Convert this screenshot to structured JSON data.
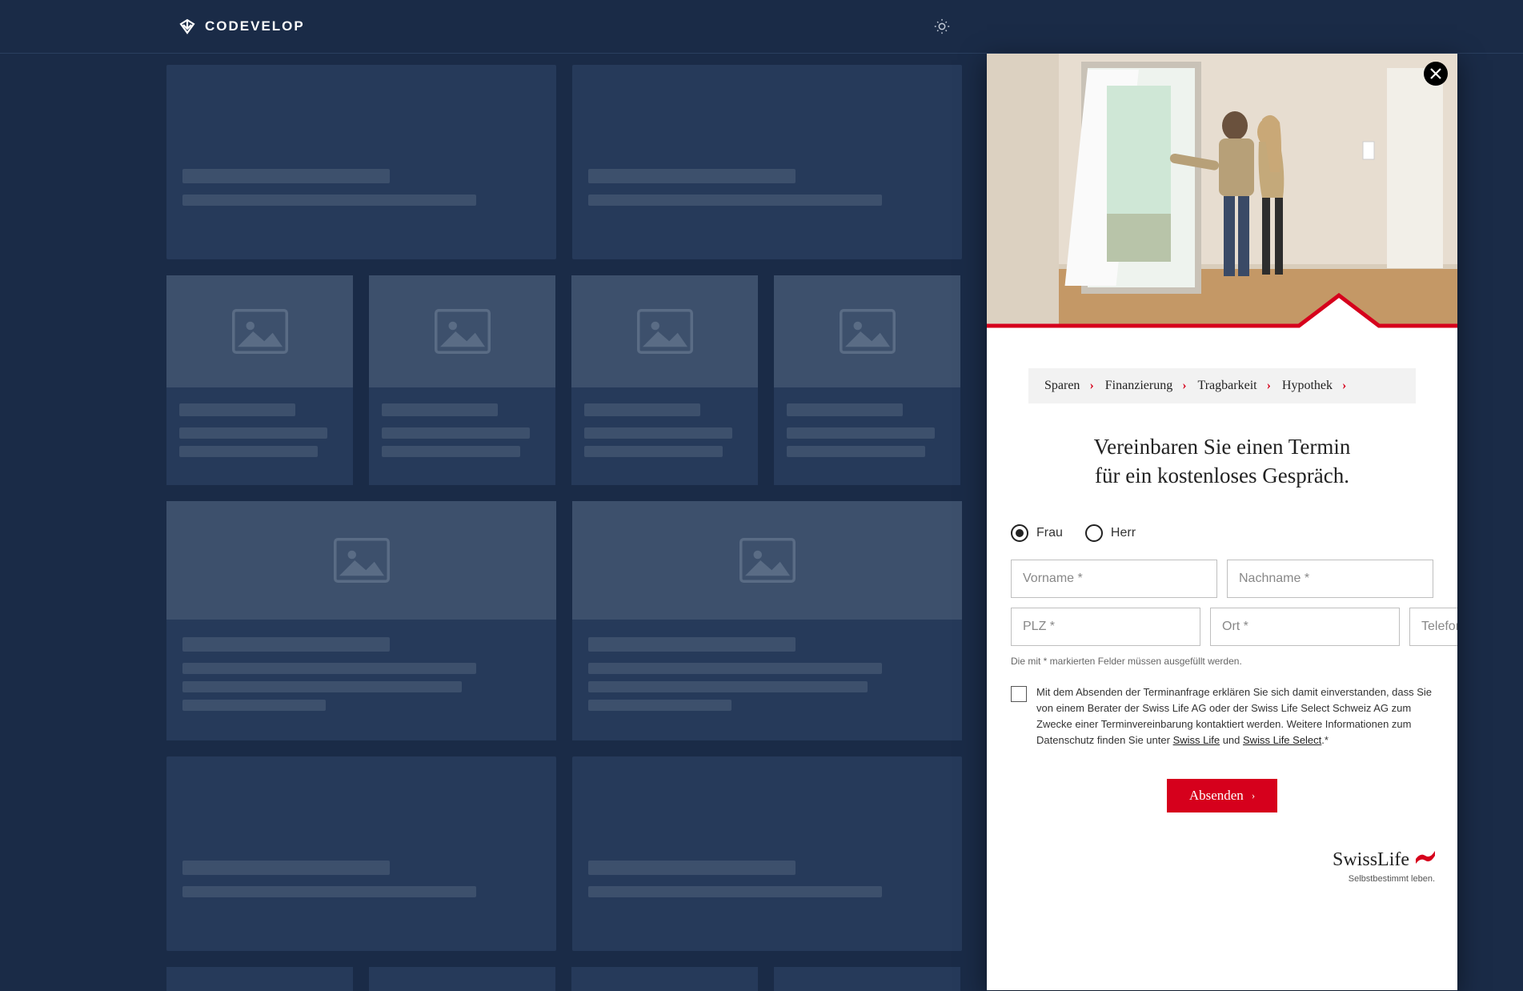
{
  "brand": {
    "name": "CODEVELOP"
  },
  "modal": {
    "steps": [
      "Sparen",
      "Finanzierung",
      "Tragbarkeit",
      "Hypothek"
    ],
    "heading_l1": "Vereinbaren Sie einen Termin",
    "heading_l2": "für ein kostenloses Gespräch.",
    "radio": {
      "frau": "Frau",
      "herr": "Herr",
      "selected": "frau"
    },
    "fields": {
      "vorname": "Vorname *",
      "nachname": "Nachname *",
      "plz": "PLZ *",
      "ort": "Ort *",
      "telefon": "Telefon *"
    },
    "hint": "Die mit * markierten Felder müssen ausgefüllt werden.",
    "consent": {
      "t1": "Mit dem Absenden der Terminanfrage erklären Sie sich damit einverstanden, dass Sie von einem Berater der Swiss Life AG oder der Swiss Life Select Schweiz AG zum Zwecke einer Terminvereinbarung kontaktiert werden. Weitere Informationen zum Datenschutz finden Sie unter ",
      "link1": "Swiss Life",
      "mid": " und ",
      "link2": "Swiss Life Select",
      "end": ".*"
    },
    "submit": "Absenden",
    "footer_brand": "SwissLife",
    "footer_tag": "Selbstbestimmt leben."
  }
}
